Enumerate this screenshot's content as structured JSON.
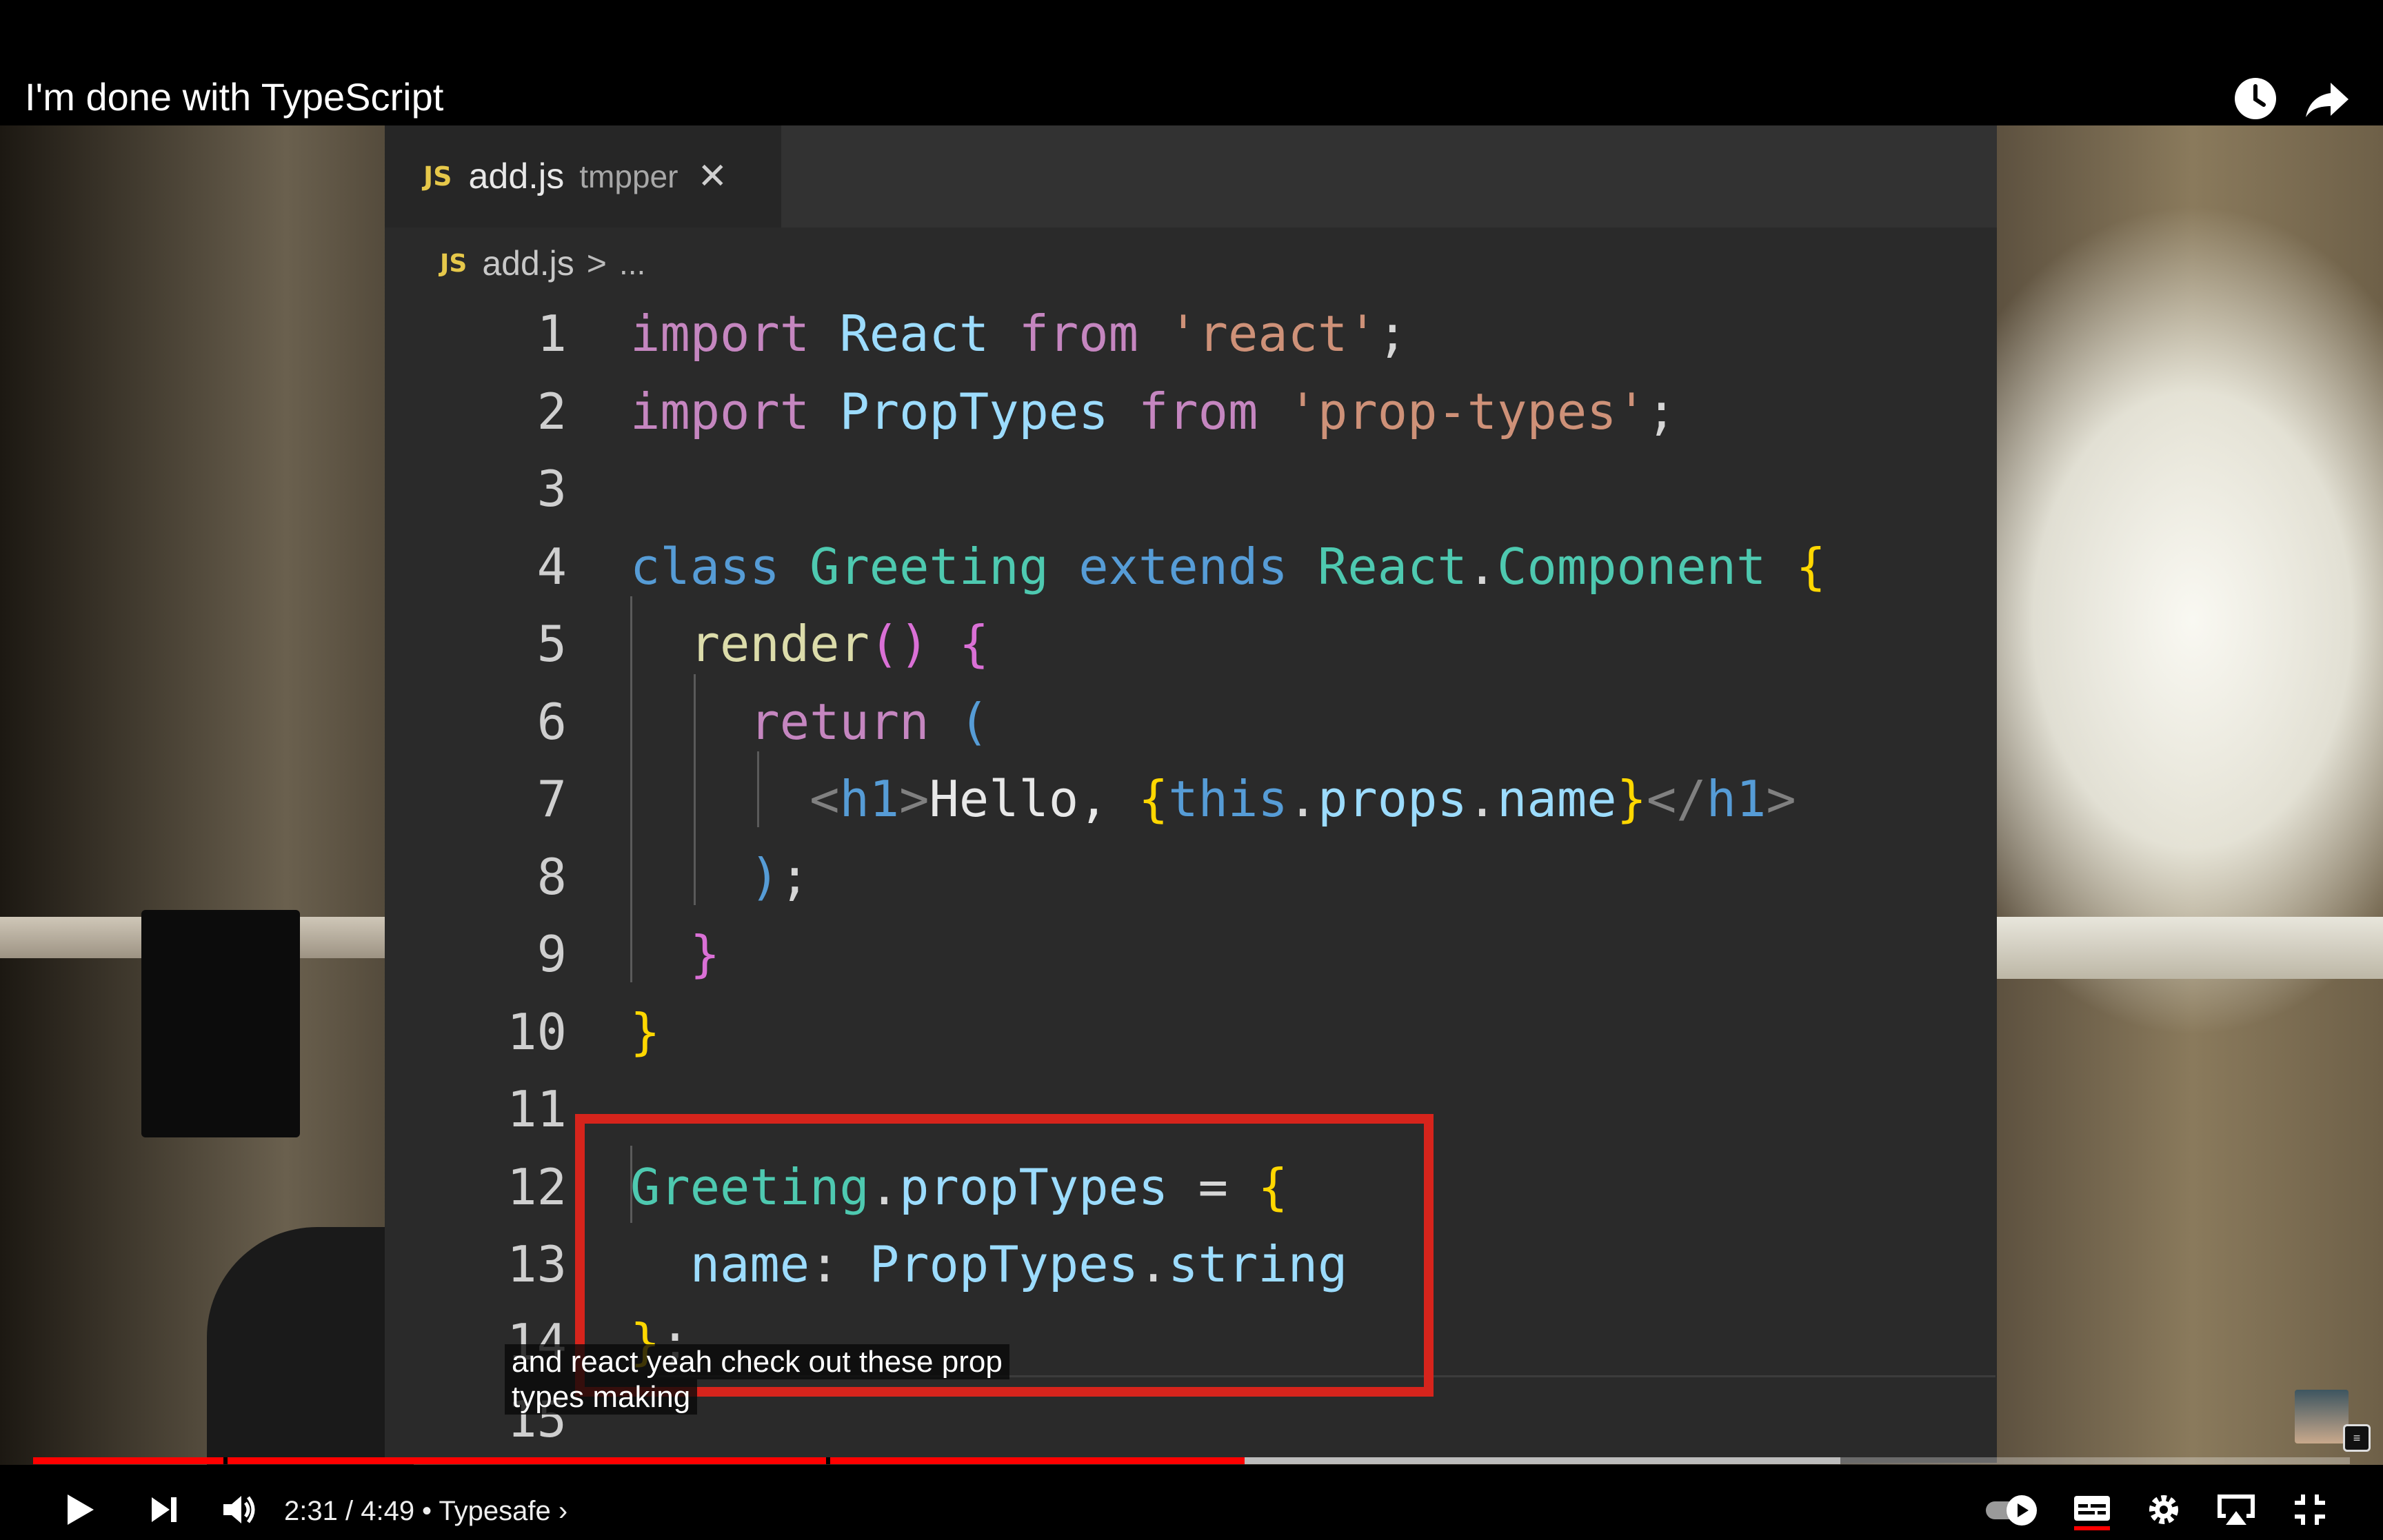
{
  "video": {
    "title": "I'm done with TypeScript"
  },
  "editor": {
    "tab": {
      "badge": "JS",
      "file_name": "add.js",
      "path_hint": "tmpper",
      "close_glyph": "✕"
    },
    "breadcrumb": {
      "badge": "JS",
      "file_name": "add.js",
      "separator": ">",
      "ellipsis": "..."
    },
    "line_numbers": [
      "1",
      "2",
      "3",
      "4",
      "5",
      "6",
      "7",
      "8",
      "9",
      "10",
      "11",
      "12",
      "13",
      "14",
      "15"
    ]
  },
  "captions": {
    "line1": "and react yeah check out these prop",
    "line2": "types making"
  },
  "player": {
    "current_time": "2:31",
    "duration": "4:49",
    "time_separator": "/",
    "chapter": "• Typesafe",
    "chapter_chevron": "›",
    "progress_fraction": 0.523,
    "buffered_fraction": 0.78,
    "autoplay_on": true,
    "colors": {
      "progress": "#ff0000",
      "highlight_box": "#d6241c"
    },
    "icons": {
      "watch_later": "clock-icon",
      "share": "share-arrow-icon",
      "play": "play-icon",
      "next": "skip-next-icon",
      "volume": "volume-icon",
      "autoplay": "autoplay-toggle",
      "captions": "subtitles-icon",
      "settings": "gear-icon",
      "cast": "airplay-icon",
      "exit_fullscreen": "exit-fullscreen-icon"
    }
  }
}
